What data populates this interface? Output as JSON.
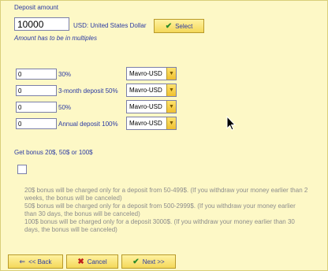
{
  "deposit": {
    "title": "Deposit amount",
    "amount_value": "10000",
    "currency_label": "USD: United States Dollar",
    "select_button": "Select",
    "hint": "Amount has to be in multiples"
  },
  "plans": [
    {
      "value": "0",
      "label": "30%",
      "currency": "Mavro-USD"
    },
    {
      "value": "0",
      "label": "3-month deposit 50%",
      "currency": "Mavro-USD"
    },
    {
      "value": "0",
      "label": "50%",
      "currency": "Mavro-USD"
    },
    {
      "value": "0",
      "label": "Annual deposit 100%",
      "currency": "Mavro-USD"
    }
  ],
  "bonus": {
    "title": "Get bonus 20$, 50$ or 100$",
    "notes": [
      "20$ bonus will be charged only for a deposit from 50-499$. (If you withdraw your money earlier than 2 weeks, the bonus will be canceled)",
      "50$ bonus will be charged only for a deposit from 500-2999$. (If you withdraw your money earlier than 30 days, the bonus will be canceled)",
      "100$ bonus will be charged only for a deposit 3000$. (If you withdraw your money earlier than 30 days, the bonus will be canceled)"
    ]
  },
  "nav": {
    "back": "<< Back",
    "cancel": "Cancel",
    "next": "Next >>"
  },
  "colors": {
    "background": "#fdf8c6",
    "text": "#2b3aa3",
    "button": "#f4d85a"
  }
}
